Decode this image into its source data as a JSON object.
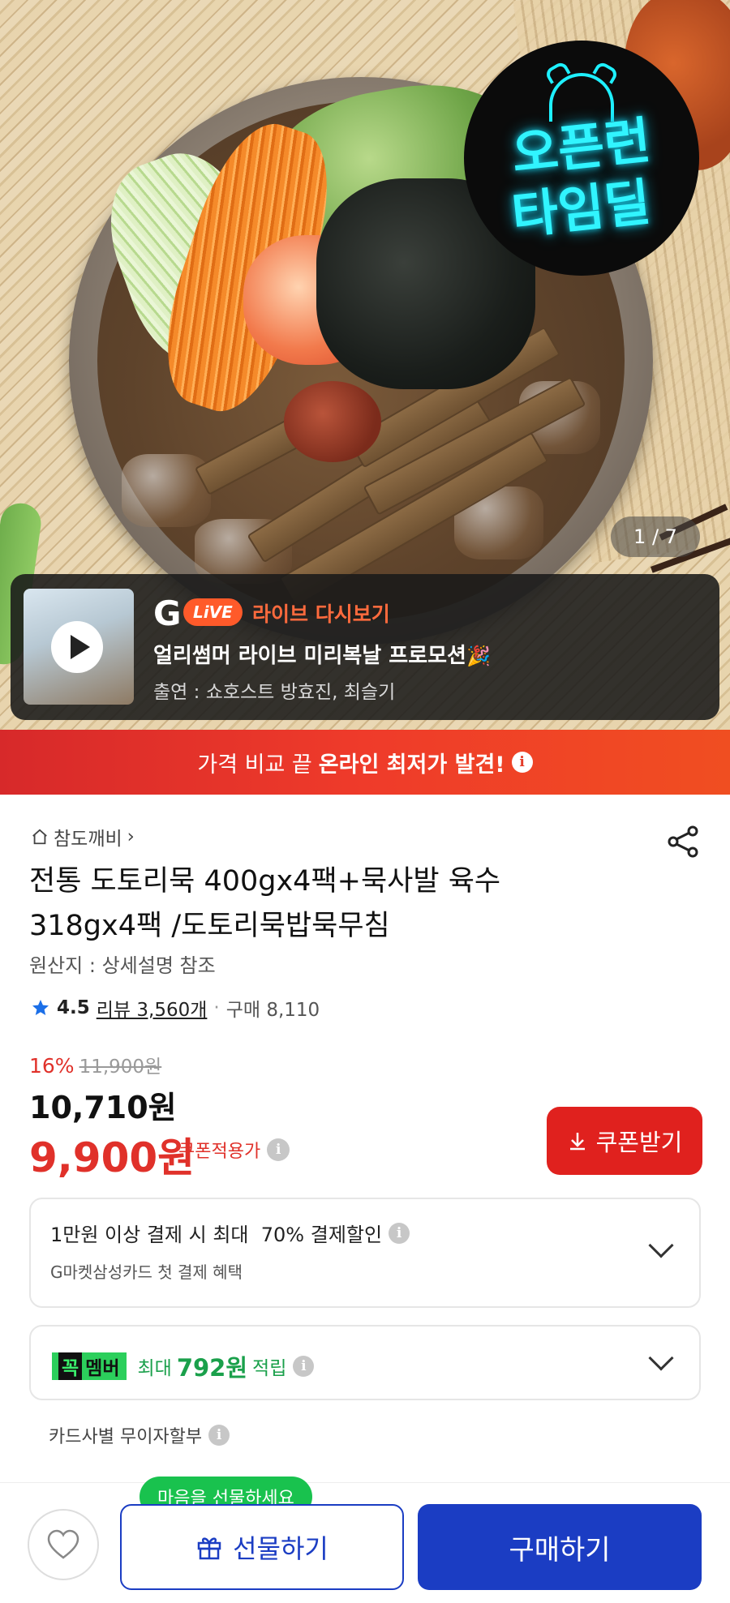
{
  "hero": {
    "badge_lines": [
      "오픈런",
      "타임딜"
    ],
    "counter": "1 / 7"
  },
  "live": {
    "g_logo": "G",
    "pill": "LiVE",
    "replay": "라이브 다시보기",
    "title": "얼리썸머 라이브 미리복날 프로모션",
    "cast": "출연 : 쇼호스트 방효진, 최슬기"
  },
  "promo": {
    "prefix": "가격 비교 끝",
    "highlight": "온라인 최저가 발견!"
  },
  "product": {
    "breadcrumb": "참도깨비",
    "title_line1": "전통 도토리묵 400gx4팩+묵사발 육수",
    "title_line2": "318gx4팩 /도토리묵밥묵무침",
    "origin": "원산지 : 상세설명 참조",
    "rating": "4.5",
    "reviews": "리뷰 3,560개",
    "buys": "구매 8,110",
    "discount_pct": "16%",
    "original_price": "11,900원",
    "price": "10,710원",
    "coupon_price": "9,900원",
    "coupon_label": "쿠폰적용가",
    "coupon_button": "쿠폰받기"
  },
  "benefits": {
    "card_line1": "1만원 이상 결제 시 최대  70% 결제할인",
    "card_line2": "G마켓삼성카드 첫 결제 혜택",
    "member_kk": "꼭",
    "member_label": "멤버",
    "member_prefix": "최대",
    "member_amount": "792원",
    "member_suffix": "적립",
    "installment": "카드사별 무이자할부"
  },
  "bottom_bar": {
    "gift_tip": "마음을 선물하세요",
    "gift_button": "선물하기",
    "buy_button": "구매하기"
  },
  "colors": {
    "brand_red": "#e0211e",
    "brand_blue": "#1b3dc3",
    "member_green": "#2ccf5c",
    "neon_cyan": "#31f4ff"
  }
}
